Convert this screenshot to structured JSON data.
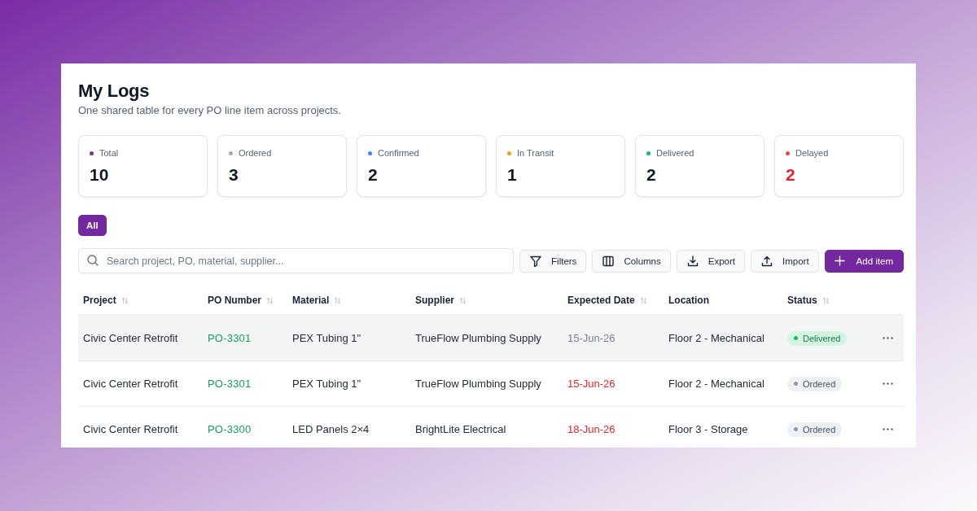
{
  "page": {
    "title": "My Logs",
    "subtitle": "One shared table for every PO line item across projects."
  },
  "stats": [
    {
      "label": "Total",
      "value": "10",
      "color": "#7b2fa5",
      "alert": false
    },
    {
      "label": "Ordered",
      "value": "3",
      "color": "#a3a8b3",
      "alert": false
    },
    {
      "label": "Confirmed",
      "value": "2",
      "color": "#3b82f6",
      "alert": false
    },
    {
      "label": "In Transit",
      "value": "1",
      "color": "#f59e0b",
      "alert": false
    },
    {
      "label": "Delivered",
      "value": "2",
      "color": "#10b981",
      "alert": false
    },
    {
      "label": "Delayed",
      "value": "2",
      "color": "#ef4444",
      "alert": true
    }
  ],
  "filters": [
    {
      "label": "All",
      "selected": true
    }
  ],
  "search": {
    "placeholder": "Search project, PO, material, supplier..."
  },
  "toolbar": [
    {
      "label": "Filters",
      "kind": "filter"
    },
    {
      "label": "Columns",
      "kind": "columns"
    },
    {
      "label": "Export",
      "kind": "export"
    },
    {
      "label": "Import",
      "kind": "import"
    },
    {
      "label": "Add item",
      "kind": "add"
    }
  ],
  "table": {
    "columns": [
      {
        "label": "Project",
        "sortable": true
      },
      {
        "label": "PO Number",
        "sortable": true
      },
      {
        "label": "Material",
        "sortable": true
      },
      {
        "label": "Supplier",
        "sortable": true
      },
      {
        "label": "Expected Date",
        "sortable": true
      },
      {
        "label": "Location",
        "sortable": false
      },
      {
        "label": "Status",
        "sortable": true
      }
    ],
    "rows": [
      {
        "highlighted": true,
        "project": "Civic Center Retrofit",
        "po_number": "PO-3301",
        "material": "PEX Tubing 1\"",
        "supplier": "TrueFlow Plumbing Supply",
        "expected_date": "15-Jun-26",
        "overdue": false,
        "location": "Floor 2 - Mechanical",
        "status": {
          "label": "Delivered",
          "kind": "delivered"
        }
      },
      {
        "highlighted": false,
        "project": "Civic Center Retrofit",
        "po_number": "PO-3301",
        "material": "PEX Tubing 1\"",
        "supplier": "TrueFlow Plumbing Supply",
        "expected_date": "15-Jun-26",
        "overdue": true,
        "location": "Floor 2 - Mechanical",
        "status": {
          "label": "Ordered",
          "kind": "ordered"
        }
      },
      {
        "highlighted": false,
        "project": "Civic Center Retrofit",
        "po_number": "PO-3300",
        "material": "LED Panels 2×4",
        "supplier": "BrightLite Electrical",
        "expected_date": "18-Jun-26",
        "overdue": true,
        "location": "Floor 3 - Storage",
        "status": {
          "label": "Ordered",
          "kind": "ordered"
        }
      }
    ]
  }
}
